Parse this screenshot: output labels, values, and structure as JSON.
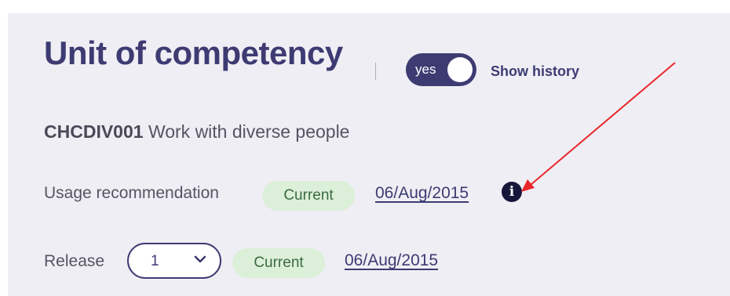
{
  "header": {
    "title": "Unit of competency",
    "toggle_label": "yes",
    "show_history_label": "Show history"
  },
  "unit": {
    "code": "CHCDIV001",
    "name": "Work with diverse people"
  },
  "usage": {
    "label": "Usage recommendation",
    "status": "Current",
    "date": "06/Aug/2015",
    "info_icon": "info-icon"
  },
  "release": {
    "label": "Release",
    "selected": "1",
    "status": "Current",
    "date": "06/Aug/2015"
  },
  "colors": {
    "brand": "#3d3b72",
    "badge_bg": "#dcefd9",
    "badge_text": "#3a6b3f",
    "annotation_arrow": "#e8262a"
  }
}
